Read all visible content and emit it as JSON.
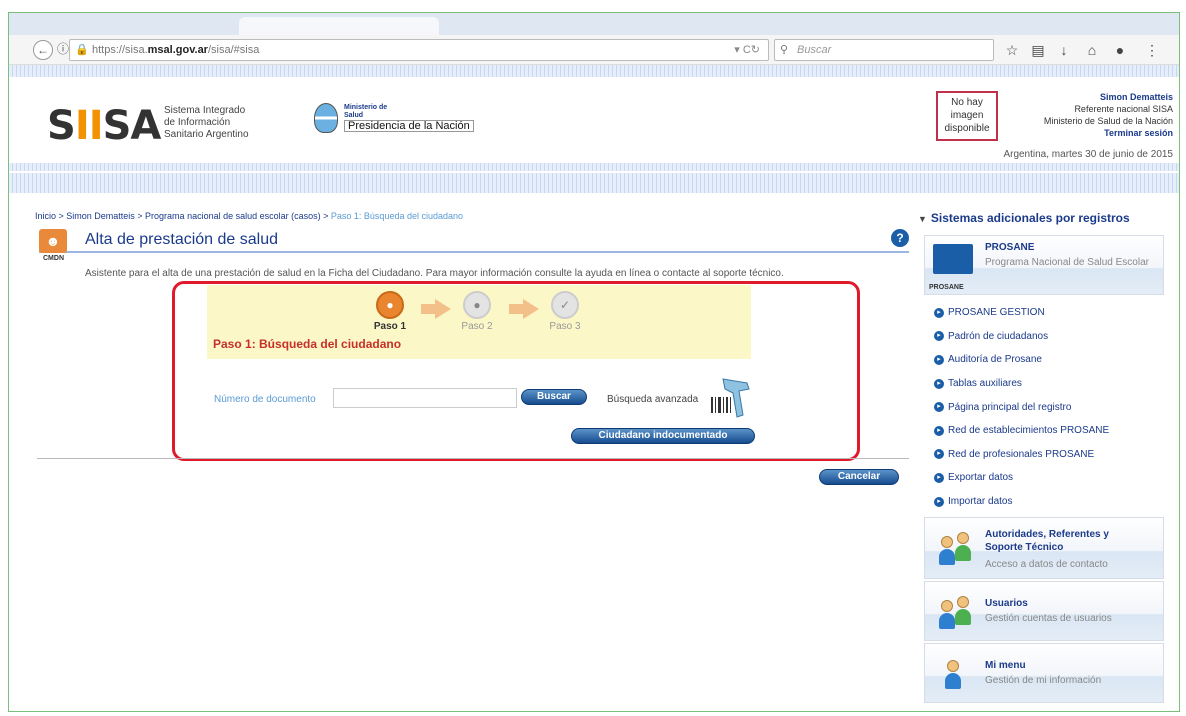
{
  "browser": {
    "url_prefix": "https://sisa.",
    "url_host": "msal.gov.ar",
    "url_path": "/sisa/#sisa",
    "search_placeholder": "Buscar"
  },
  "header": {
    "logo": "SIISA",
    "logo_sub_1": "Sistema Integrado",
    "logo_sub_2": "de Información",
    "logo_sub_3": "Sanitario Argentino",
    "ministry_line_1": "Ministerio de",
    "ministry_line_2": "Salud",
    "presidency": "Presidencia de la Nación",
    "no_image_1": "No hay",
    "no_image_2": "imagen",
    "no_image_3": "disponible",
    "user_name": "Simon Dematteis",
    "user_role": "Referente nacional SISA",
    "user_org": "Ministerio de Salud de la Nación",
    "logout": "Terminar sesión",
    "date": "Argentina, martes 30 de junio de 2015"
  },
  "breadcrumb": {
    "path": "Inicio > Simon Dematteis > Programa nacional de salud escolar (casos) > ",
    "current": "Paso 1: Búsqueda del ciudadano"
  },
  "page": {
    "cmdn_label": "CMDN",
    "title": "Alta de prestación de salud",
    "help": "?",
    "intro": "Asistente para el alta de una prestación de salud en la Ficha del Ciudadano. Para mayor información consulte la ayuda en línea o contacte al soporte técnico."
  },
  "wizard": {
    "steps": [
      {
        "label": "Paso 1"
      },
      {
        "label": "Paso 2"
      },
      {
        "label": "Paso 3"
      }
    ],
    "heading": "Paso 1: Búsqueda del ciudadano",
    "doc_label": "Número de documento",
    "doc_value": "",
    "search_button": "Buscar",
    "advanced_search": "Búsqueda avanzada",
    "undocumented_button": "Ciudadano indocumentado",
    "cancel_button": "Cancelar"
  },
  "sidebar": {
    "title": "Sistemas adicionales por registros",
    "prosane": {
      "logo_text": "PROSANE",
      "title": "PROSANE",
      "subtitle": "Programa Nacional de Salud Escolar"
    },
    "links": [
      "PROSANE GESTION",
      "Padrón de ciudadanos",
      "Auditoría de Prosane",
      "Tablas auxiliares",
      "Página principal del registro",
      "Red de establecimientos PROSANE",
      "Red de profesionales PROSANE",
      "Exportar datos",
      "Importar datos"
    ],
    "blocks": [
      {
        "title": "Autoridades, Referentes y Soporte Técnico",
        "subtitle": "Acceso a datos de contacto"
      },
      {
        "title": "Usuarios",
        "subtitle": "Gestión cuentas de usuarios"
      },
      {
        "title": "Mi menu",
        "subtitle": "Gestión de mi información"
      }
    ]
  },
  "colors": {
    "accent_blue": "#1b3a8a",
    "highlight_red": "#e0192b",
    "step_panel": "#fbf7c7"
  }
}
